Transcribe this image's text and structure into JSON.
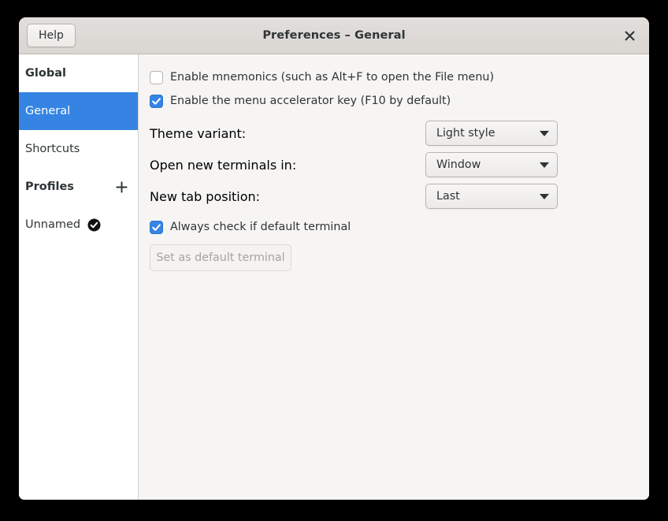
{
  "window": {
    "title": "Preferences – General",
    "help_label": "Help",
    "close_icon": "close-icon",
    "accent_color": "#3584e4",
    "headerbar_color": "#dad6d2",
    "content_bg": "#f6f5f4"
  },
  "sidebar": {
    "groups": [
      {
        "header": "Global",
        "items": [
          {
            "label": "General",
            "selected": true
          },
          {
            "label": "Shortcuts",
            "selected": false
          }
        ]
      },
      {
        "header": "Profiles",
        "action_icon": "plus-icon",
        "items": [
          {
            "label": "Unnamed",
            "selected": false,
            "badge_icon": "check-circle-icon",
            "is_default": true
          }
        ]
      }
    ]
  },
  "content": {
    "checkboxes_top": [
      {
        "label": "Enable mnemonics (such as Alt+F to open the File menu)",
        "checked": false
      },
      {
        "label": "Enable the menu accelerator key (F10 by default)",
        "checked": true
      }
    ],
    "combos": [
      {
        "label": "Theme variant:",
        "value": "Light style"
      },
      {
        "label": "Open new terminals in:",
        "value": "Window"
      },
      {
        "label": "New tab position:",
        "value": "Last"
      }
    ],
    "default_terminal_check": {
      "label": "Always check if default terminal",
      "checked": true
    },
    "default_terminal_button": {
      "label": "Set as default terminal",
      "disabled": true
    }
  }
}
